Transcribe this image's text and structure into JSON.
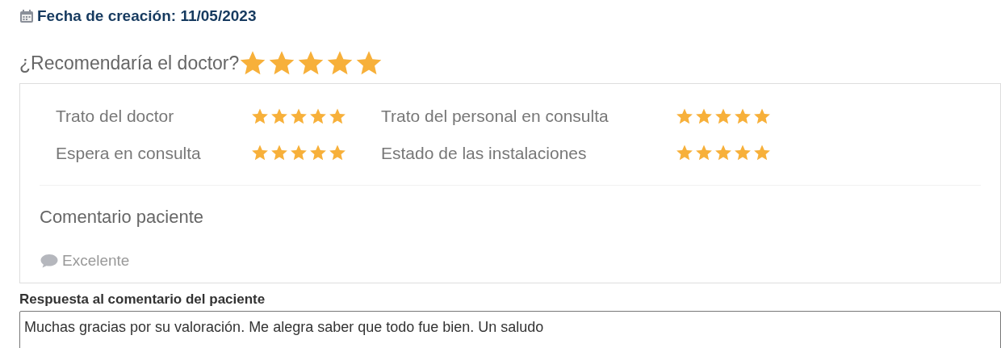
{
  "created": {
    "label": "Fecha de creación: 11/05/2023"
  },
  "recommend": {
    "question": "¿Recomendaría el doctor?",
    "stars": 5
  },
  "ratings": [
    {
      "label": "Trato del doctor",
      "stars": 5
    },
    {
      "label": "Trato del personal en consulta",
      "stars": 5
    },
    {
      "label": "Espera en consulta",
      "stars": 5
    },
    {
      "label": "Estado de las instalaciones",
      "stars": 5
    }
  ],
  "comment": {
    "heading": "Comentario paciente",
    "text": "Excelente"
  },
  "reply": {
    "label": "Respuesta al comentario del paciente",
    "value": "Muchas gracias por su valoración. Me alegra saber que todo fue bien. Un saludo"
  }
}
